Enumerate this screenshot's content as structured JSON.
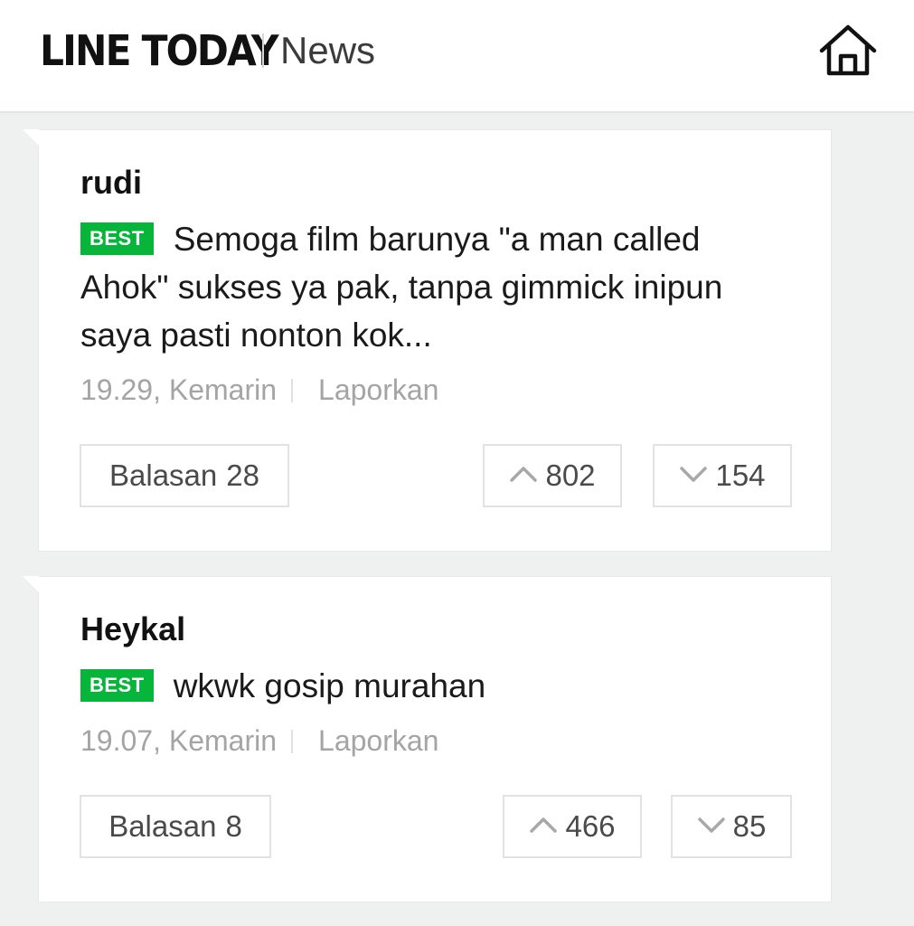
{
  "header": {
    "logo": "LINE TODAY",
    "section": "News",
    "home_icon": "home-icon"
  },
  "comments": [
    {
      "author": "rudi",
      "badge": "BEST",
      "text": "Semoga film barunya \"a man called Ahok\" sukses ya pak, tanpa gimmick inipun saya pasti nonton kok...",
      "time": "19.29, Kemarin",
      "report": "Laporkan",
      "reply_label": "Balasan",
      "reply_count": "28",
      "upvotes": "802",
      "downvotes": "154"
    },
    {
      "author": "Heykal",
      "badge": "BEST",
      "text": "wkwk gosip murahan",
      "time": "19.07, Kemarin",
      "report": "Laporkan",
      "reply_label": "Balasan",
      "reply_count": "8",
      "upvotes": "466",
      "downvotes": "85"
    }
  ],
  "colors": {
    "accent": "#07b53b",
    "background": "#eef1f0",
    "muted_text": "#a4a4a4"
  }
}
